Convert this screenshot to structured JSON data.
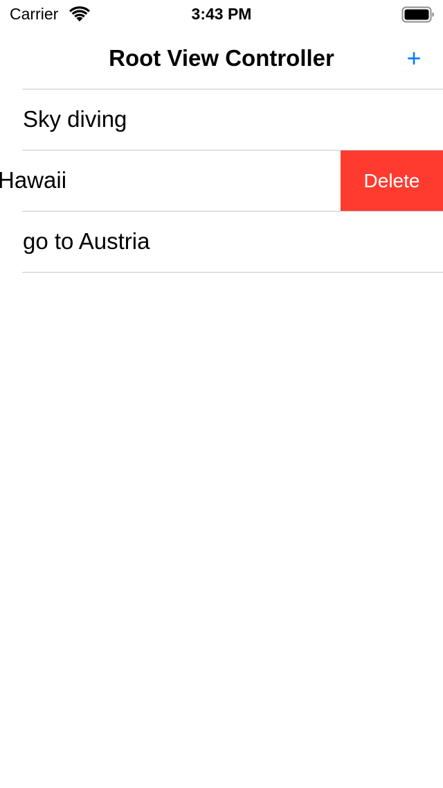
{
  "status_bar": {
    "carrier": "Carrier",
    "time": "3:43 PM",
    "wifi_icon": "wifi-icon",
    "battery_icon": "battery-icon"
  },
  "nav_bar": {
    "title": "Root View Controller",
    "add_label": "+",
    "add_icon": "plus-icon"
  },
  "rows": [
    {
      "label": "Sky diving"
    },
    {
      "label": "Hawaii",
      "swiped": true,
      "action_label": "Delete"
    },
    {
      "label": "go to Austria"
    }
  ],
  "colors": {
    "accent": "#007aff",
    "delete": "#ff3b30",
    "separator": "#c8c7cc",
    "text": "#000000"
  }
}
